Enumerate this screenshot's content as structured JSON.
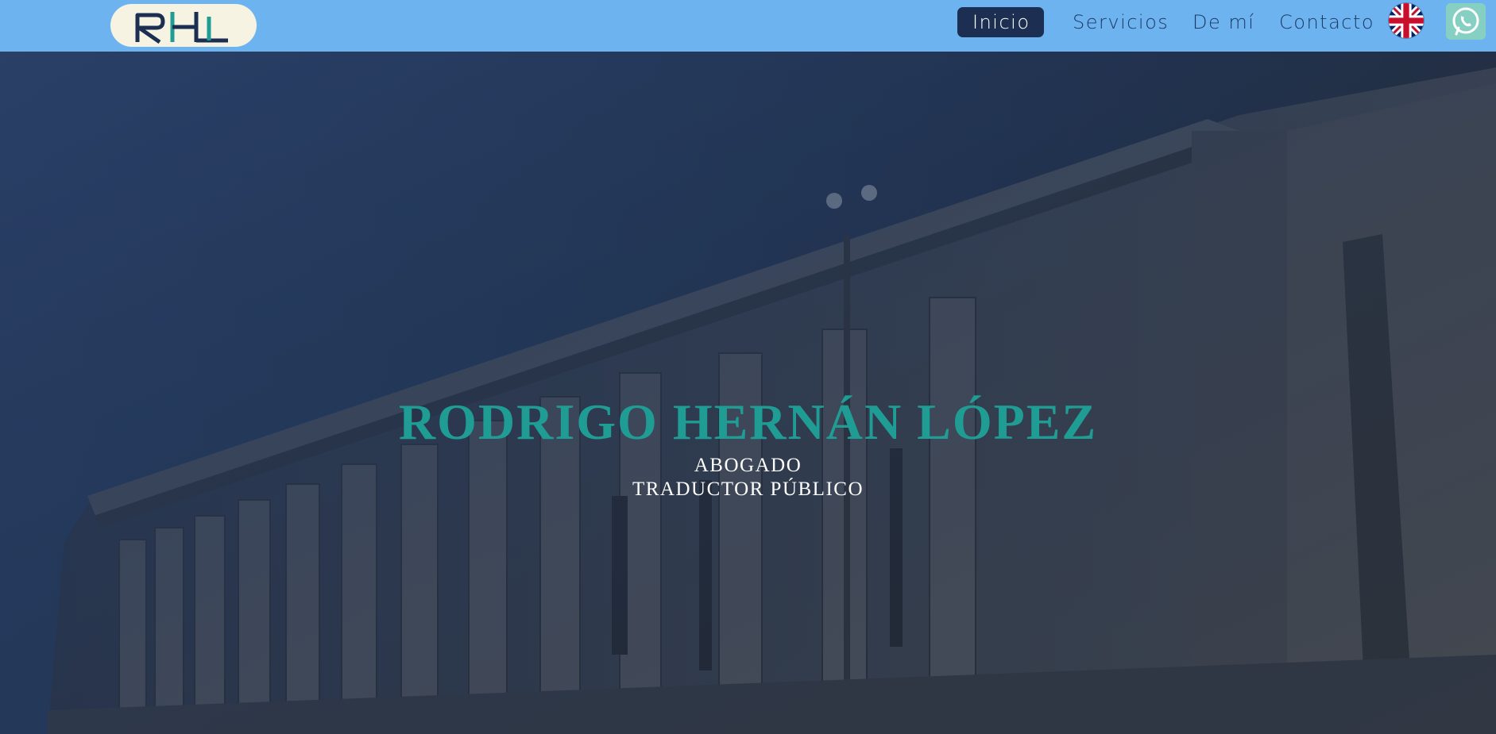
{
  "header": {
    "logo": {
      "icon": "rhl-monogram-logo",
      "text": "RHL"
    },
    "nav": [
      {
        "label": "Inicio",
        "active": true
      },
      {
        "label": "Servicios",
        "active": false
      },
      {
        "label": "De mí",
        "active": false
      },
      {
        "label": "Contacto",
        "active": false
      }
    ],
    "language_flag_icon": "uk-flag-icon",
    "whatsapp_icon": "whatsapp-icon"
  },
  "hero": {
    "name": "RODRIGO HERNÁN LÓPEZ",
    "lines": [
      "ABOGADO",
      "TRADUCTOR PÚBLICO"
    ],
    "background_image": "courthouse-columns-photo"
  },
  "colors": {
    "navbar": "#6db3ef",
    "nav_active_bg": "#1c2f52",
    "nav_text": "#1e3a64",
    "title": "#1f9c93",
    "hero_overlay": "#1f3150"
  }
}
